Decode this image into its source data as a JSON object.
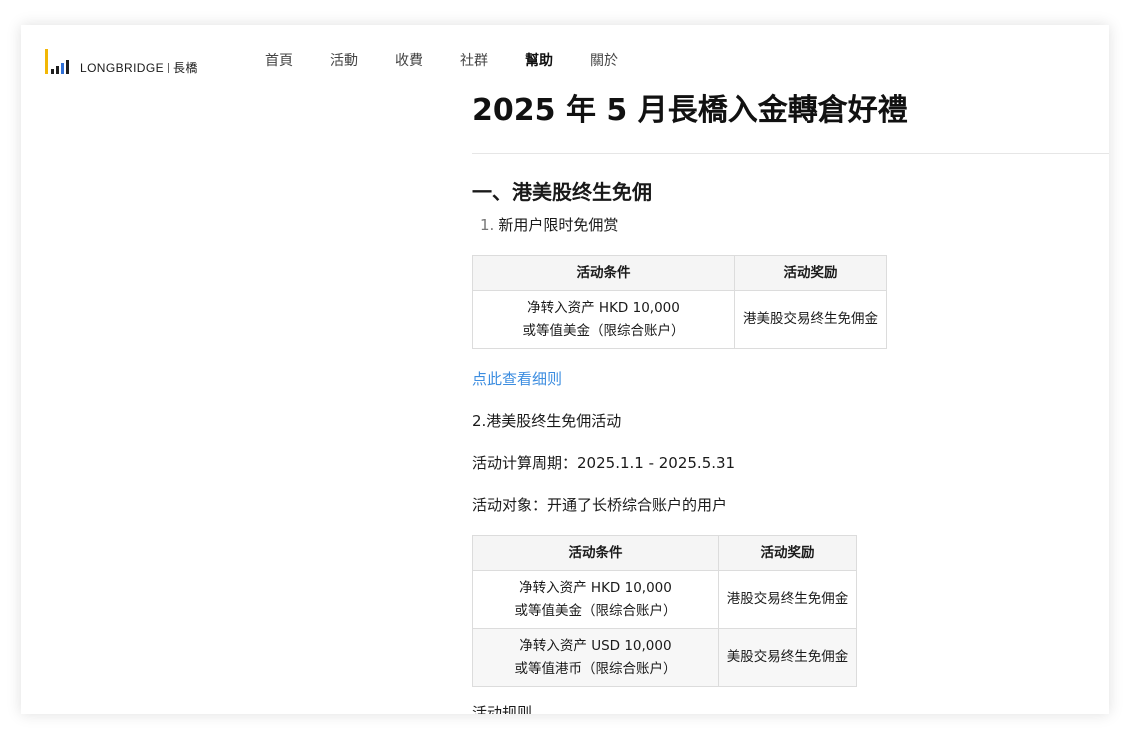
{
  "brand": {
    "name": "LONGBRIDGE",
    "name_cn": "長橋",
    "colors": {
      "accent_yellow": "#f2b705",
      "accent_blue": "#2f6fd6",
      "link": "#3c8de0"
    }
  },
  "nav": {
    "items": [
      {
        "label": "首頁",
        "active": false
      },
      {
        "label": "活動",
        "active": false
      },
      {
        "label": "收費",
        "active": false
      },
      {
        "label": "社群",
        "active": false
      },
      {
        "label": "幫助",
        "active": true
      },
      {
        "label": "關於",
        "active": false
      }
    ]
  },
  "article": {
    "title": "2025 年 5 月長橋入金轉倉好禮",
    "section1": {
      "heading": "一、港美股终生免佣",
      "item1": {
        "number": "1.",
        "label": "新用户限时免佣赏"
      },
      "table": {
        "headers": [
          "活动条件",
          "活动奖励"
        ],
        "rows": [
          {
            "condition_line1": "净转入资产 HKD 10,000",
            "condition_line2": "或等值美金（限综合账户）",
            "reward": "港美股交易终生免佣金"
          }
        ]
      },
      "details_link": "点此查看细则",
      "item2": "2.港美股终生免佣活动",
      "period_label": "活动计算周期：",
      "period_value": "2025.1.1 - 2025.5.31",
      "target_label": "活动对象：",
      "target_value": "开通了长桥综合账户的用户",
      "table2": {
        "headers": [
          "活动条件",
          "活动奖励"
        ],
        "rows": [
          {
            "condition_line1": "净转入资产 HKD 10,000",
            "condition_line2": "或等值美金（限综合账户）",
            "reward": "港股交易终生免佣金"
          },
          {
            "condition_line1": "净转入资产 USD 10,000",
            "condition_line2": "或等值港币（限综合账户）",
            "reward": "美股交易终生免佣金"
          }
        ]
      },
      "cut_text": "活动规则"
    }
  }
}
